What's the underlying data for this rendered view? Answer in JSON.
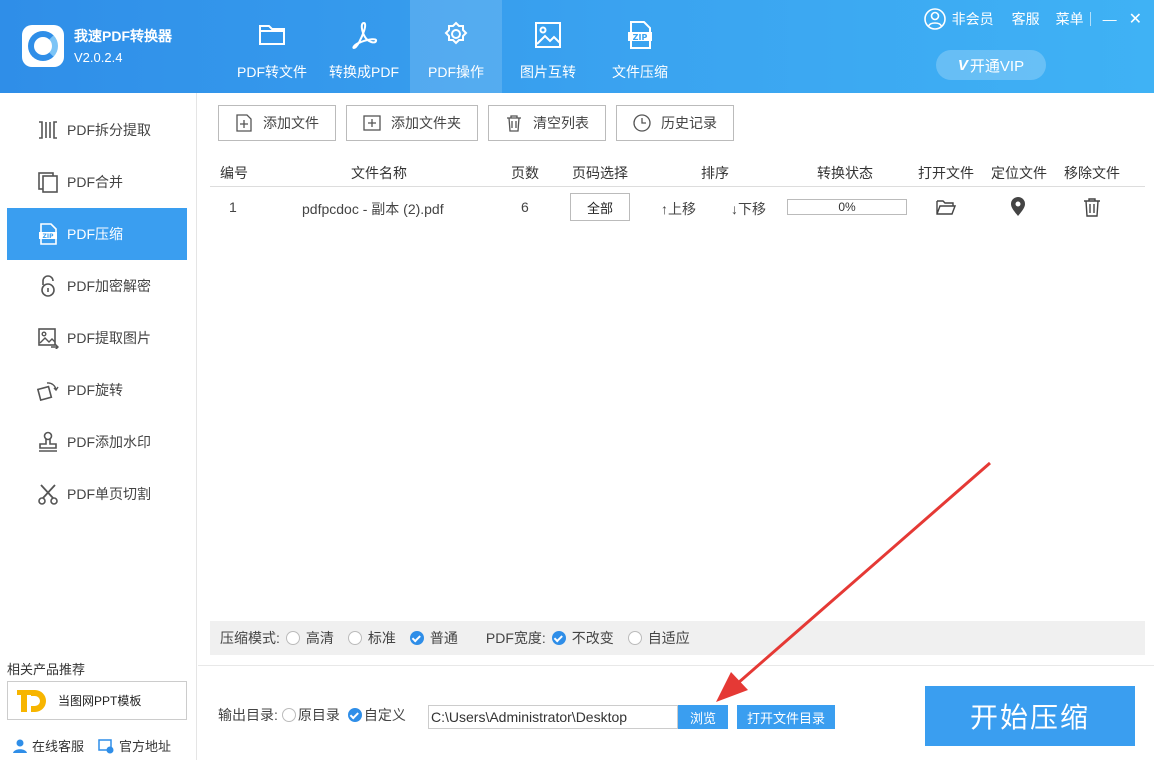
{
  "app": {
    "title": "我速PDF转换器",
    "version": "V2.0.2.4"
  },
  "nav": {
    "tabs": [
      {
        "label": "PDF转文件",
        "icon": "folder-icon"
      },
      {
        "label": "转换成PDF",
        "icon": "acrobat-icon"
      },
      {
        "label": "PDF操作",
        "icon": "gear-icon",
        "active": true
      },
      {
        "label": "图片互转",
        "icon": "image-icon"
      },
      {
        "label": "文件压缩",
        "icon": "zip-icon"
      }
    ]
  },
  "top_right": {
    "member": "非会员",
    "service": "客服",
    "menu": "菜单",
    "minimize": "—",
    "close": "✕"
  },
  "vip": {
    "badge": "V",
    "label": "开通VIP"
  },
  "sidebar": {
    "items": [
      {
        "label": "PDF拆分提取",
        "icon": "split-icon"
      },
      {
        "label": "PDF合并",
        "icon": "merge-icon"
      },
      {
        "label": "PDF压缩",
        "icon": "zip-icon",
        "active": true
      },
      {
        "label": "PDF加密解密",
        "icon": "lock-icon"
      },
      {
        "label": "PDF提取图片",
        "icon": "image-extract-icon"
      },
      {
        "label": "PDF旋转",
        "icon": "rotate-icon"
      },
      {
        "label": "PDF添加水印",
        "icon": "stamp-icon"
      },
      {
        "label": "PDF单页切割",
        "icon": "scissors-icon"
      }
    ],
    "related_title": "相关产品推荐",
    "related_product": "当图网PPT模板",
    "online_service": "在线客服",
    "official_site": "官方地址"
  },
  "toolbar": {
    "add_file": "添加文件",
    "add_folder": "添加文件夹",
    "clear_list": "清空列表",
    "history": "历史记录"
  },
  "table": {
    "headers": [
      "编号",
      "文件名称",
      "页数",
      "页码选择",
      "排序",
      "转换状态",
      "打开文件",
      "定位文件",
      "移除文件"
    ],
    "rows": [
      {
        "index": "1",
        "name": "pdfpcdoc - 副本 (2).pdf",
        "pages": "6",
        "page_select": "全部",
        "move_up": "↑上移",
        "move_down": "↓下移",
        "progress": "0%"
      }
    ]
  },
  "options": {
    "mode_label": "压缩模式:",
    "modes": [
      {
        "label": "高清",
        "checked": false
      },
      {
        "label": "标准",
        "checked": false
      },
      {
        "label": "普通",
        "checked": true
      }
    ],
    "width_label": "PDF宽度:",
    "widths": [
      {
        "label": "不改变",
        "checked": true
      },
      {
        "label": "自适应",
        "checked": false
      }
    ]
  },
  "output": {
    "label": "输出目录:",
    "original": "原目录",
    "custom": "自定义",
    "original_checked": false,
    "custom_checked": true,
    "path": "C:\\Users\\Administrator\\Desktop",
    "browse": "浏览",
    "open_dir": "打开文件目录"
  },
  "start_button": "开始压缩",
  "colors": {
    "primary": "#3a9ef0",
    "header_start": "#2f8ee8",
    "header_end": "#3fb2f5",
    "annotation_arrow": "#e53935"
  }
}
